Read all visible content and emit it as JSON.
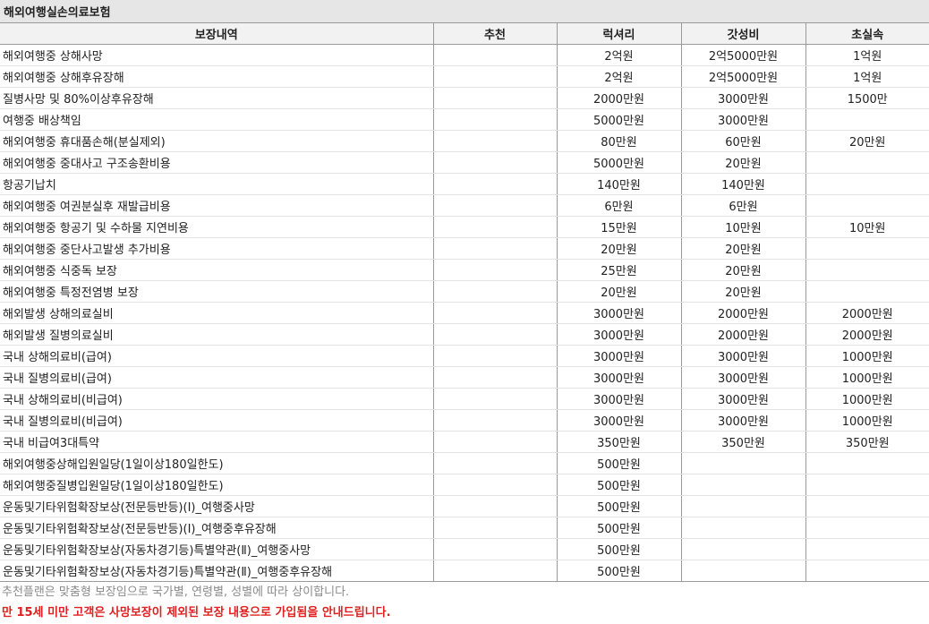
{
  "title": "해외여행실손의료보험",
  "columns": [
    "보장내역",
    "추천",
    "럭셔리",
    "갓성비",
    "초실속"
  ],
  "rows": [
    {
      "item": "해외여행중 상해사망",
      "recommend": "",
      "luxury": "2억원",
      "value": "2억5000만원",
      "basic": "1억원"
    },
    {
      "item": "해외여행중 상해후유장해",
      "recommend": "",
      "luxury": "2억원",
      "value": "2억5000만원",
      "basic": "1억원"
    },
    {
      "item": "질병사망 및 80%이상후유장해",
      "recommend": "",
      "luxury": "2000만원",
      "value": "3000만원",
      "basic": "1500만"
    },
    {
      "item": "여행중 배상책임",
      "recommend": "",
      "luxury": "5000만원",
      "value": "3000만원",
      "basic": ""
    },
    {
      "item": "해외여행중 휴대품손해(분실제외)",
      "recommend": "",
      "luxury": "80만원",
      "value": "60만원",
      "basic": "20만원"
    },
    {
      "item": "해외여행중 중대사고 구조송환비용",
      "recommend": "",
      "luxury": "5000만원",
      "value": "20만원",
      "basic": ""
    },
    {
      "item": "항공기납치",
      "recommend": "",
      "luxury": "140만원",
      "value": "140만원",
      "basic": ""
    },
    {
      "item": "해외여행중 여권분실후 재발급비용",
      "recommend": "",
      "luxury": "6만원",
      "value": "6만원",
      "basic": ""
    },
    {
      "item": "해외여행중 항공기 및 수하물 지연비용",
      "recommend": "",
      "luxury": "15만원",
      "value": "10만원",
      "basic": "10만원"
    },
    {
      "item": "해외여행중 중단사고발생 추가비용",
      "recommend": "",
      "luxury": "20만원",
      "value": "20만원",
      "basic": ""
    },
    {
      "item": "해외여행중 식중독 보장",
      "recommend": "",
      "luxury": "25만원",
      "value": "20만원",
      "basic": ""
    },
    {
      "item": "해외여행중 특정전염병 보장",
      "recommend": "",
      "luxury": "20만원",
      "value": "20만원",
      "basic": ""
    },
    {
      "item": "해외발생 상해의료실비",
      "recommend": "",
      "luxury": "3000만원",
      "value": "2000만원",
      "basic": "2000만원"
    },
    {
      "item": "해외발생 질병의료실비",
      "recommend": "",
      "luxury": "3000만원",
      "value": "2000만원",
      "basic": "2000만원"
    },
    {
      "item": "국내 상해의료비(급여)",
      "recommend": "",
      "luxury": "3000만원",
      "value": "3000만원",
      "basic": "1000만원"
    },
    {
      "item": "국내 질병의료비(급여)",
      "recommend": "",
      "luxury": "3000만원",
      "value": "3000만원",
      "basic": "1000만원"
    },
    {
      "item": "국내 상해의료비(비급여)",
      "recommend": "",
      "luxury": "3000만원",
      "value": "3000만원",
      "basic": "1000만원"
    },
    {
      "item": "국내 질병의료비(비급여)",
      "recommend": "",
      "luxury": "3000만원",
      "value": "3000만원",
      "basic": "1000만원"
    },
    {
      "item": "국내 비급여3대특약",
      "recommend": "",
      "luxury": "350만원",
      "value": "350만원",
      "basic": "350만원"
    },
    {
      "item": "해외여행중상해입원일당(1일이상180일한도)",
      "recommend": "",
      "luxury": "500만원",
      "value": "",
      "basic": ""
    },
    {
      "item": "해외여행중질병입원일당(1일이상180일한도)",
      "recommend": "",
      "luxury": "500만원",
      "value": "",
      "basic": ""
    },
    {
      "item": "운동및기타위험확장보상(전문등반등)(Ⅰ)_여행중사망",
      "recommend": "",
      "luxury": "500만원",
      "value": "",
      "basic": ""
    },
    {
      "item": "운동및기타위험확장보상(전문등반등)(Ⅰ)_여행중후유장해",
      "recommend": "",
      "luxury": "500만원",
      "value": "",
      "basic": ""
    },
    {
      "item": "운동및기타위험확장보상(자동차경기등)특별약관(Ⅱ)_여행중사망",
      "recommend": "",
      "luxury": "500만원",
      "value": "",
      "basic": ""
    },
    {
      "item": "운동및기타위험확장보상(자동차경기등)특별약관(Ⅱ)_여행중후유장해",
      "recommend": "",
      "luxury": "500만원",
      "value": "",
      "basic": ""
    }
  ],
  "notes": {
    "gray": "추천플랜은 맞춤형 보장임으로 국가별, 연령별, 성별에 따라 상이합니다.",
    "red": "만 15세 미만 고객은 사망보장이 제외된 보장 내용으로 가입됨을 안내드립니다."
  }
}
